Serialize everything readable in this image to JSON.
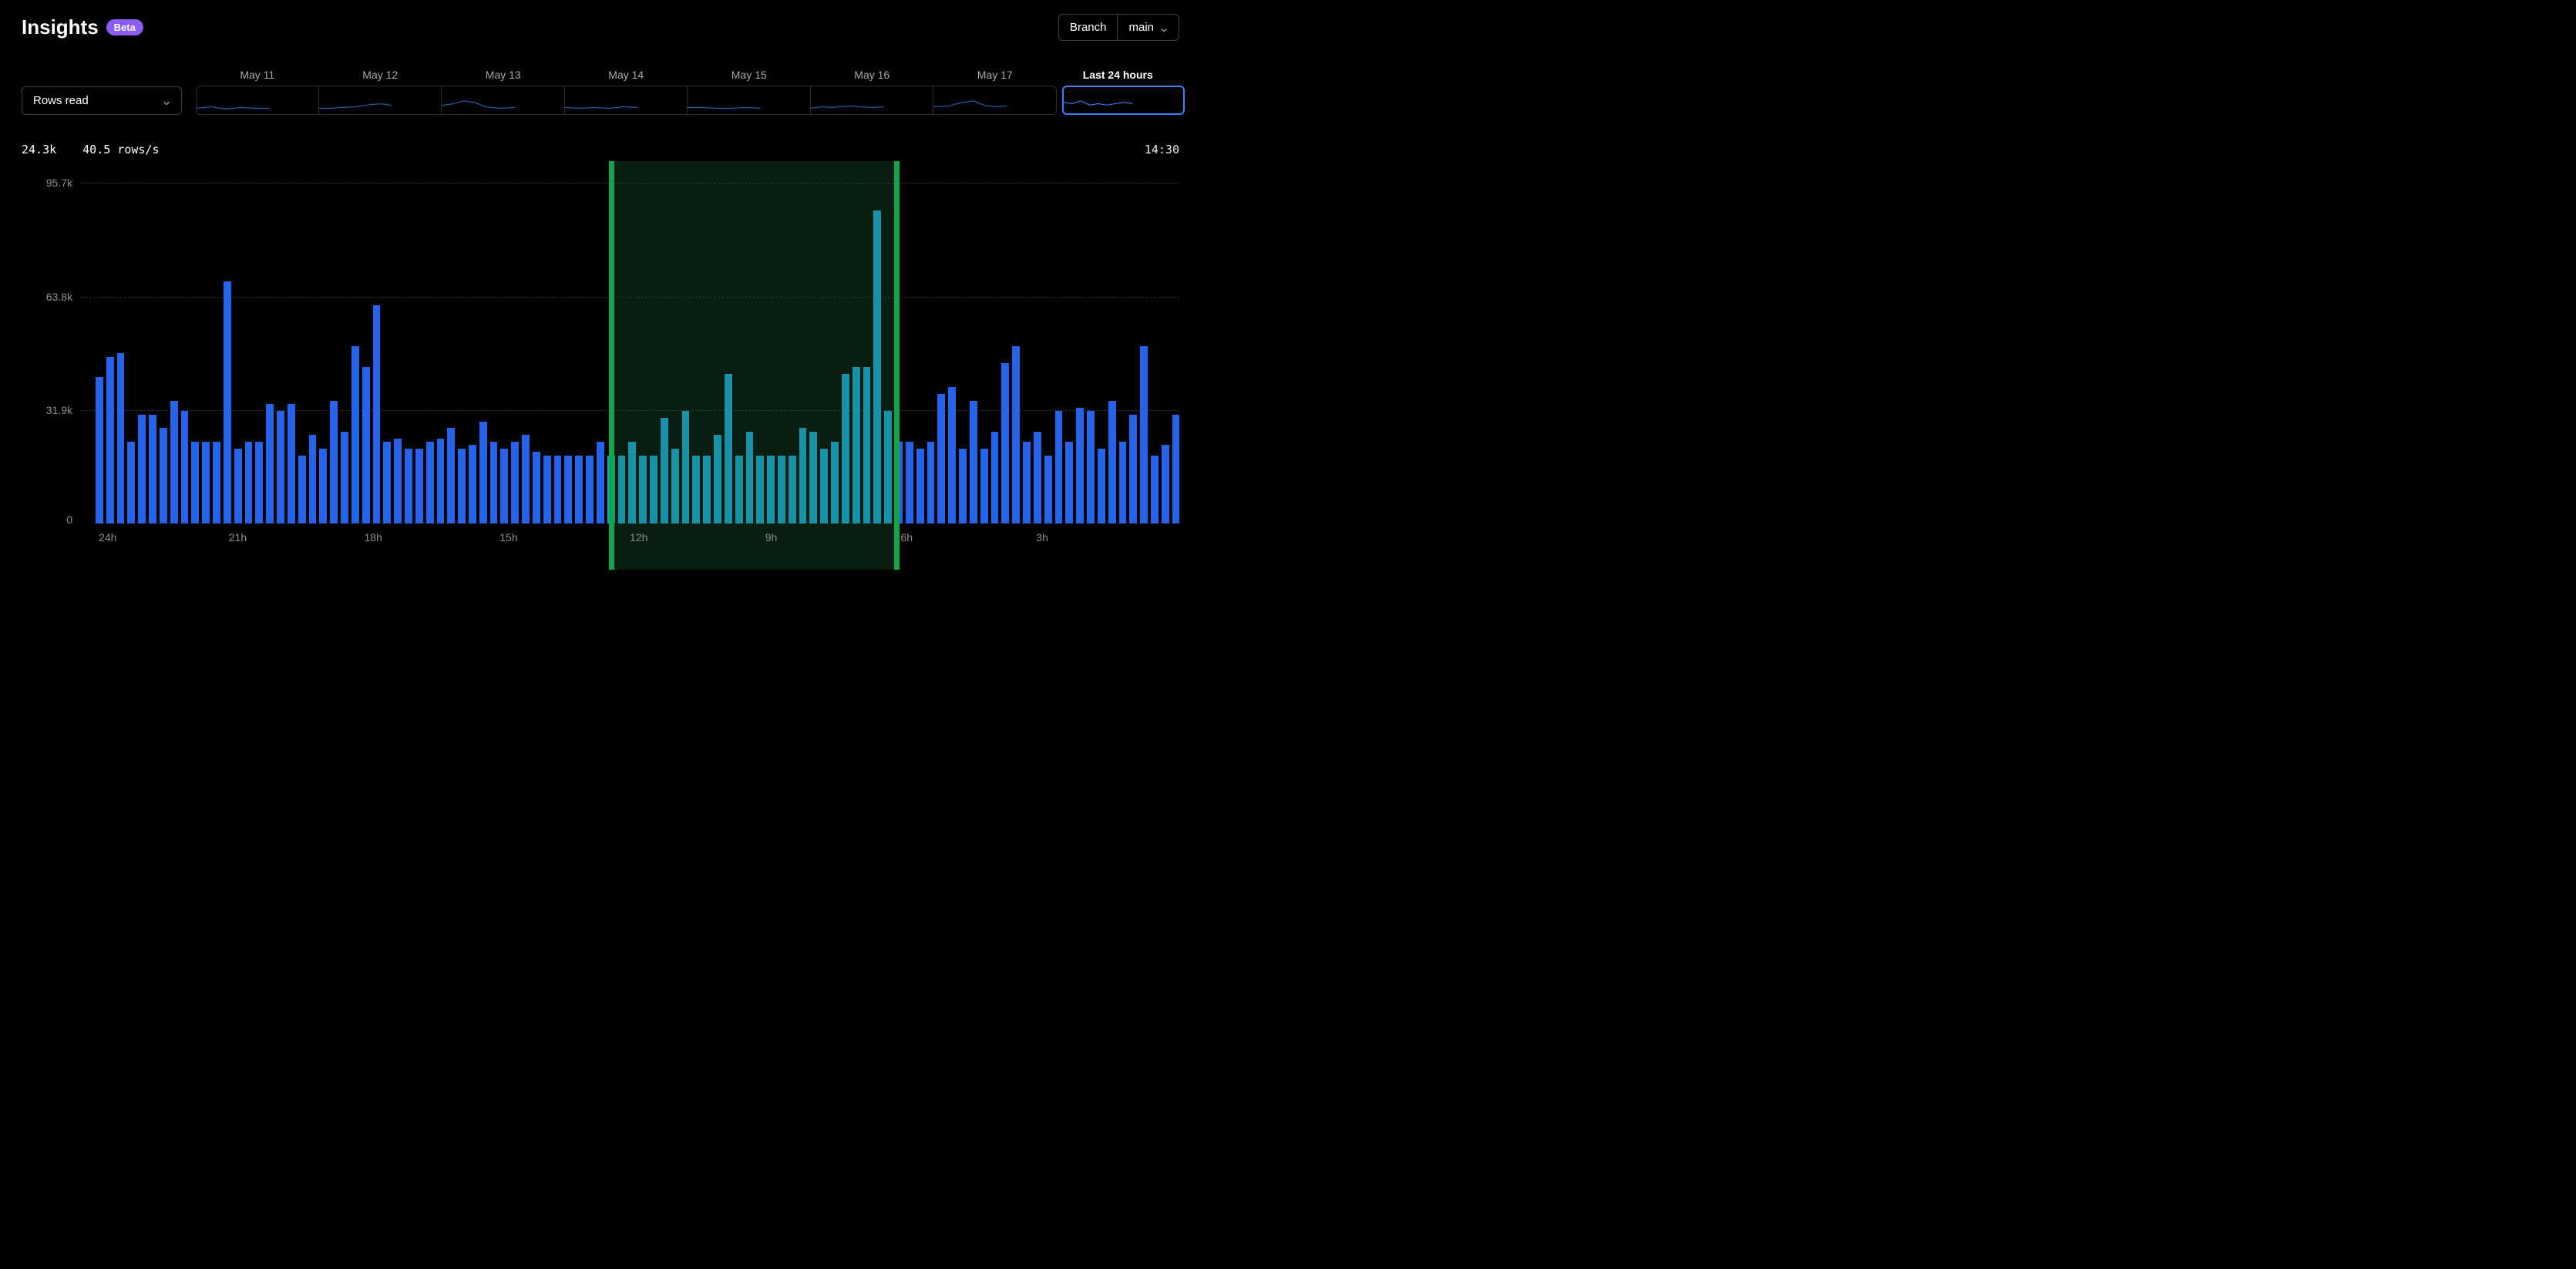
{
  "header": {
    "title": "Insights",
    "badge": "Beta",
    "branch_label": "Branch",
    "branch_value": "main"
  },
  "metric_select": {
    "value": "Rows read"
  },
  "day_nav": {
    "days": [
      "May 11",
      "May 12",
      "May 13",
      "May 14",
      "May 15",
      "May 16",
      "May 17"
    ],
    "active_label": "Last 24 hours"
  },
  "stats": {
    "total": "24.3k",
    "rate": "40.5 rows/s",
    "time": "14:30"
  },
  "chart_data": {
    "type": "bar",
    "title": "",
    "xlabel": "",
    "ylabel": "",
    "ylim": [
      0,
      100000
    ],
    "y_ticks": [
      "0",
      "31.9k",
      "63.8k",
      "95.7k"
    ],
    "x_ticks": [
      "24h",
      "21h",
      "18h",
      "15h",
      "12h",
      "9h",
      "6h",
      "3h"
    ],
    "highlight": {
      "start_index": 48,
      "end_index": 74
    },
    "values": [
      43000,
      49000,
      50000,
      24000,
      32000,
      32000,
      28000,
      36000,
      33000,
      24000,
      24000,
      24000,
      71000,
      22000,
      24000,
      24000,
      35000,
      33000,
      35000,
      20000,
      26000,
      22000,
      36000,
      27000,
      52000,
      46000,
      64000,
      24000,
      25000,
      22000,
      22000,
      24000,
      25000,
      28000,
      22000,
      23000,
      30000,
      24000,
      22000,
      24000,
      26000,
      21000,
      20000,
      20000,
      20000,
      20000,
      20000,
      24000,
      20000,
      20000,
      24000,
      20000,
      20000,
      31000,
      22000,
      33000,
      20000,
      20000,
      26000,
      44000,
      20000,
      27000,
      20000,
      20000,
      20000,
      20000,
      28000,
      27000,
      22000,
      24000,
      44000,
      46000,
      46000,
      92000,
      33000,
      24000,
      24000,
      22000,
      24000,
      38000,
      40000,
      22000,
      36000,
      22000,
      27000,
      47000,
      52000,
      24000,
      27000,
      20000,
      33000,
      24000,
      34000,
      33000,
      22000,
      36000,
      24000,
      32000,
      52000,
      20000,
      23000,
      32000
    ]
  }
}
